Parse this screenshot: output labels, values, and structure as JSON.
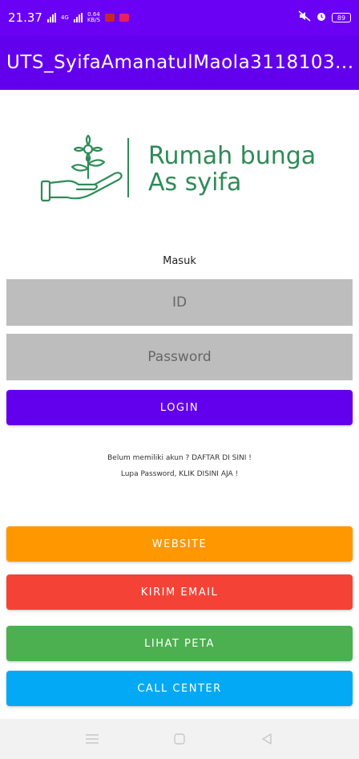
{
  "status_bar": {
    "time": "21.37",
    "net_speed_top": "0.64",
    "net_speed_bottom": "KB/S",
    "net_type": "4G",
    "battery": "89"
  },
  "app_bar": {
    "title": "UTS_SyifaAmanatulMaola3118103..."
  },
  "logo": {
    "line1": "Rumah bunga",
    "line2": "As syifa"
  },
  "login": {
    "heading": "Masuk",
    "id_placeholder": "ID",
    "password_placeholder": "Password",
    "login_label": "LOGIN",
    "register_text": "Belum memiliki akun ? DAFTAR DI SINI !",
    "forgot_text": "Lupa Password, KLIK DISINI AJA !"
  },
  "actions": {
    "website_label": "WEBSITE",
    "email_label": "KIRIM EMAIL",
    "map_label": "LIHAT PETA",
    "call_label": "CALL CENTER"
  },
  "colors": {
    "primary": "#6200ee",
    "website": "#ff9800",
    "email": "#f44336",
    "map": "#4caf50",
    "call": "#03a9f4",
    "brand_green": "#2e8b57"
  }
}
